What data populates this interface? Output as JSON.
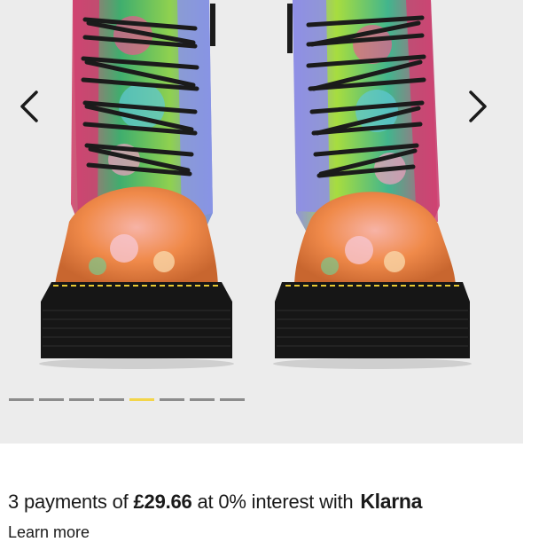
{
  "product": {
    "image": "floral patchwork lace-up platform boots",
    "image_count": 8,
    "active_image_index": 4
  },
  "navigation": {
    "prev_icon": "chevron-left-icon",
    "next_icon": "chevron-right-icon"
  },
  "payment": {
    "prefix": "3 payments of ",
    "amount": "£29.66",
    "middle": " at 0% interest with ",
    "provider": "Klarna",
    "learn_more": "Learn more"
  },
  "colors": {
    "gallery_background": "#ececec",
    "pager_active": "#f3d54a",
    "pager_inactive": "#8c8c8c"
  }
}
